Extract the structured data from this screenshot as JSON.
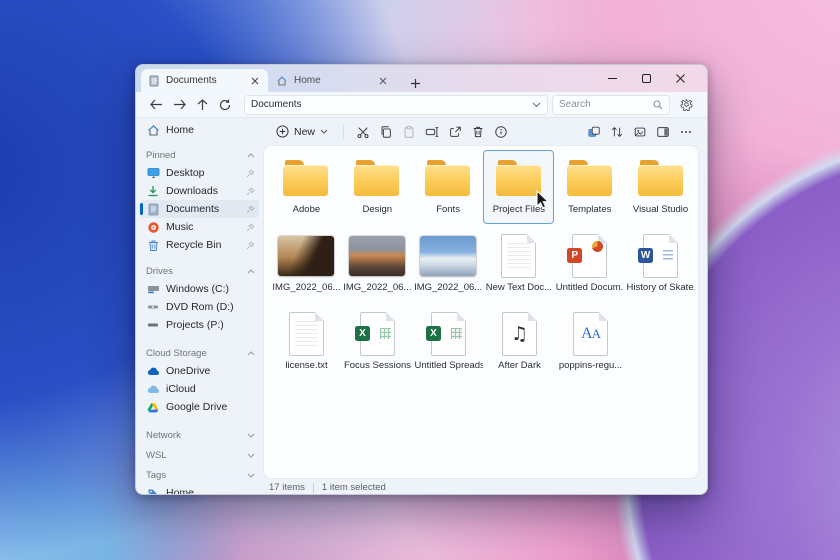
{
  "colors": {
    "accent": "#0067c0",
    "selection_border": "#66a1d8",
    "folder_yellow": "#f8c94c",
    "wallpaper_blue": "#2a50c6",
    "wallpaper_pink": "#f0a8d2",
    "wallpaper_purple": "#8a5cc6"
  },
  "tabs": {
    "items": [
      {
        "label": "Documents",
        "active": true
      },
      {
        "label": "Home",
        "active": false
      }
    ]
  },
  "navbar": {
    "address": "Documents",
    "search_placeholder": "Search"
  },
  "toolbar": {
    "new_label": "New"
  },
  "sidebar": {
    "home": {
      "label": "Home"
    },
    "sections": [
      {
        "label": "Pinned",
        "collapsed": false,
        "items": [
          {
            "label": "Desktop",
            "icon": "desktop-icon",
            "pinned": true
          },
          {
            "label": "Downloads",
            "icon": "downloads-icon",
            "pinned": true
          },
          {
            "label": "Documents",
            "icon": "document-icon",
            "pinned": true,
            "selected": true
          },
          {
            "label": "Music",
            "icon": "music-icon",
            "pinned": true
          },
          {
            "label": "Recycle Bin",
            "icon": "recycle-bin-icon",
            "pinned": true
          }
        ]
      },
      {
        "label": "Drives",
        "collapsed": false,
        "items": [
          {
            "label": "Windows (C:)",
            "icon": "drive-icon"
          },
          {
            "label": "DVD Rom (D:)",
            "icon": "dvd-icon"
          },
          {
            "label": "Projects (P:)",
            "icon": "drive-icon"
          }
        ]
      },
      {
        "label": "Cloud Storage",
        "collapsed": false,
        "items": [
          {
            "label": "OneDrive",
            "icon": "onedrive-icon"
          },
          {
            "label": "iCloud",
            "icon": "icloud-icon"
          },
          {
            "label": "Google Drive",
            "icon": "google-drive-icon"
          }
        ]
      },
      {
        "label": "Network",
        "collapsed": true,
        "items": []
      },
      {
        "label": "WSL",
        "collapsed": true,
        "items": []
      },
      {
        "label": "Tags",
        "collapsed": true,
        "items": [
          {
            "label": "Home",
            "icon": "tag-icon"
          }
        ]
      }
    ]
  },
  "files": {
    "selected_name": "Project Files",
    "rows": [
      [
        {
          "name": "Adobe",
          "type": "folder"
        },
        {
          "name": "Design",
          "type": "folder"
        },
        {
          "name": "Fonts",
          "type": "folder"
        },
        {
          "name": "Project Files",
          "type": "folder",
          "selected": true
        },
        {
          "name": "Templates",
          "type": "folder"
        },
        {
          "name": "Visual Studio",
          "type": "folder"
        }
      ],
      [
        {
          "name": "IMG_2022_06...",
          "type": "image"
        },
        {
          "name": "IMG_2022_06...",
          "type": "image"
        },
        {
          "name": "IMG_2022_06...",
          "type": "image"
        },
        {
          "name": "New Text Doc...",
          "type": "text"
        },
        {
          "name": "Untitled Docum...",
          "type": "powerpoint"
        },
        {
          "name": "History of Skate...",
          "type": "word"
        }
      ],
      [
        {
          "name": "license.txt",
          "type": "text"
        },
        {
          "name": "Focus Sessions",
          "type": "excel"
        },
        {
          "name": "Untitled Spreads...",
          "type": "excel"
        },
        {
          "name": "After Dark",
          "type": "audio"
        },
        {
          "name": "poppins-regu...",
          "type": "font"
        }
      ]
    ]
  },
  "statusbar": {
    "items_count": "17 items",
    "selection_count": "1 item selected"
  }
}
